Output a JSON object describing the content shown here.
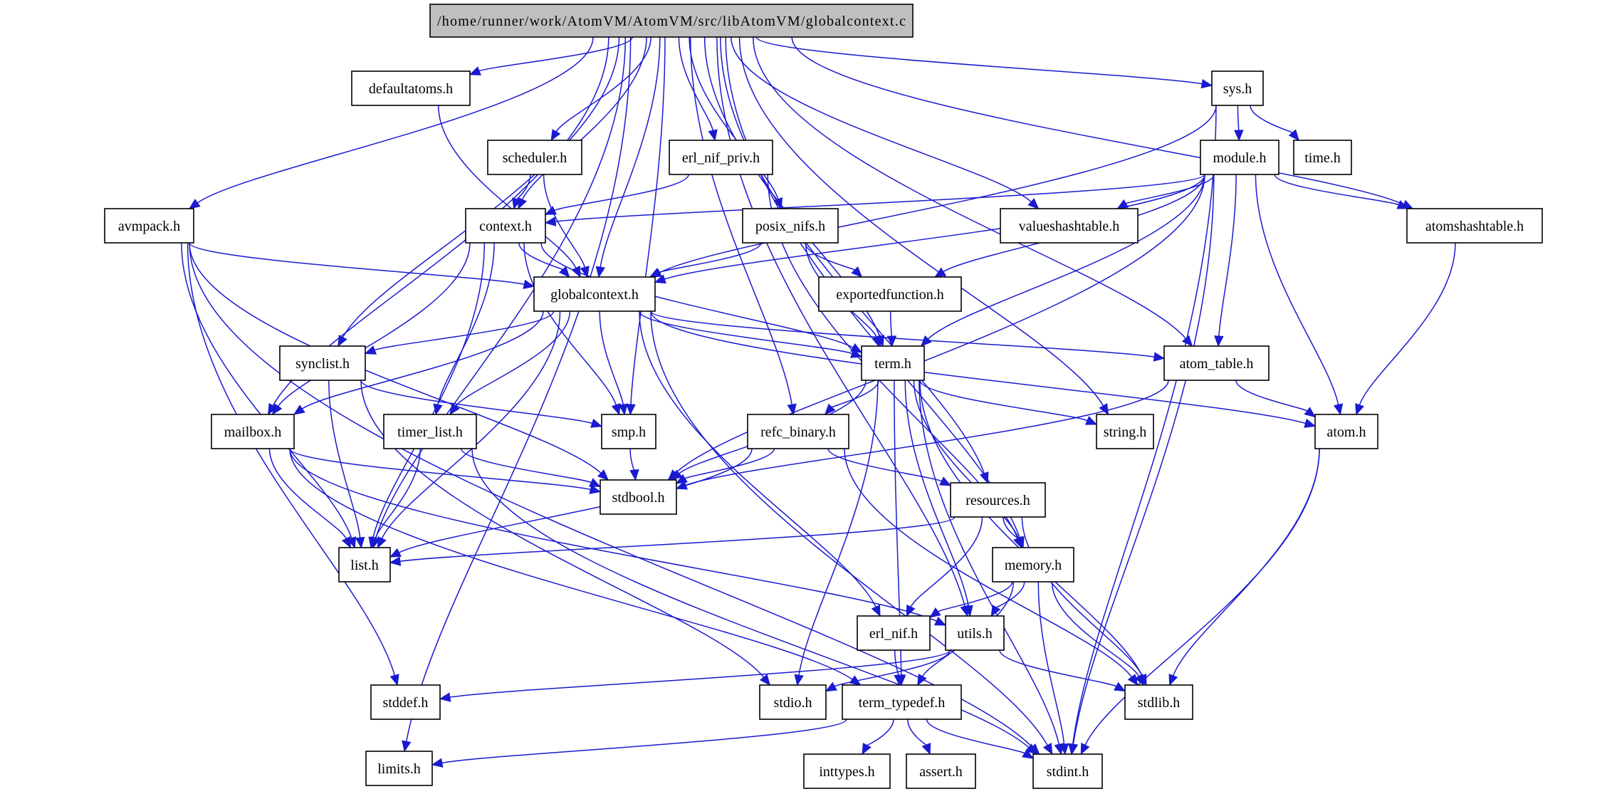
{
  "diagram": {
    "type": "include-dependency-graph",
    "title": "/home/runner/work/AtomVM/AtomVM/src/libAtomVM/globalcontext.c",
    "colors": {
      "edge": "#1a1ad0",
      "root_fill": "#bfbfbf",
      "node_fill": "#ffffff",
      "node_border": "#000000"
    },
    "nodes": [
      {
        "id": "root",
        "label": "/home/runner/work/AtomVM/AtomVM/src/libAtomVM/globalcontext.c",
        "root": true
      },
      {
        "id": "defaultatoms",
        "label": "defaultatoms.h"
      },
      {
        "id": "sys",
        "label": "sys.h"
      },
      {
        "id": "scheduler",
        "label": "scheduler.h"
      },
      {
        "id": "erl_nif_priv",
        "label": "erl_nif_priv.h"
      },
      {
        "id": "module",
        "label": "module.h"
      },
      {
        "id": "time",
        "label": "time.h"
      },
      {
        "id": "avmpack",
        "label": "avmpack.h"
      },
      {
        "id": "context",
        "label": "context.h"
      },
      {
        "id": "posix_nifs",
        "label": "posix_nifs.h"
      },
      {
        "id": "valueshashtable",
        "label": "valueshashtable.h"
      },
      {
        "id": "atomshashtable",
        "label": "atomshashtable.h"
      },
      {
        "id": "globalcontext",
        "label": "globalcontext.h"
      },
      {
        "id": "exportedfunction",
        "label": "exportedfunction.h"
      },
      {
        "id": "synclist",
        "label": "synclist.h"
      },
      {
        "id": "term",
        "label": "term.h"
      },
      {
        "id": "atom_table",
        "label": "atom_table.h"
      },
      {
        "id": "mailbox",
        "label": "mailbox.h"
      },
      {
        "id": "timer_list",
        "label": "timer_list.h"
      },
      {
        "id": "smp",
        "label": "smp.h"
      },
      {
        "id": "refc_binary",
        "label": "refc_binary.h"
      },
      {
        "id": "string",
        "label": "string.h"
      },
      {
        "id": "atom",
        "label": "atom.h"
      },
      {
        "id": "stdbool",
        "label": "stdbool.h"
      },
      {
        "id": "resources",
        "label": "resources.h"
      },
      {
        "id": "list",
        "label": "list.h"
      },
      {
        "id": "memory",
        "label": "memory.h"
      },
      {
        "id": "erl_nif",
        "label": "erl_nif.h"
      },
      {
        "id": "utils",
        "label": "utils.h"
      },
      {
        "id": "stddef",
        "label": "stddef.h"
      },
      {
        "id": "stdio",
        "label": "stdio.h"
      },
      {
        "id": "term_typedef",
        "label": "term_typedef.h"
      },
      {
        "id": "stdlib",
        "label": "stdlib.h"
      },
      {
        "id": "limits",
        "label": "limits.h"
      },
      {
        "id": "inttypes",
        "label": "inttypes.h"
      },
      {
        "id": "assert",
        "label": "assert.h"
      },
      {
        "id": "stdint",
        "label": "stdint.h"
      }
    ],
    "edges": [
      [
        "root",
        "defaultatoms"
      ],
      [
        "root",
        "sys"
      ],
      [
        "root",
        "scheduler"
      ],
      [
        "root",
        "erl_nif_priv"
      ],
      [
        "root",
        "avmpack"
      ],
      [
        "root",
        "context"
      ],
      [
        "root",
        "posix_nifs"
      ],
      [
        "root",
        "valueshashtable"
      ],
      [
        "root",
        "atomshashtable"
      ],
      [
        "root",
        "globalcontext"
      ],
      [
        "root",
        "synclist"
      ],
      [
        "root",
        "term"
      ],
      [
        "root",
        "atom_table"
      ],
      [
        "root",
        "mailbox"
      ],
      [
        "root",
        "smp"
      ],
      [
        "root",
        "refc_binary"
      ],
      [
        "root",
        "string"
      ],
      [
        "root",
        "resources"
      ],
      [
        "root",
        "list"
      ],
      [
        "root",
        "memory"
      ],
      [
        "root",
        "utils"
      ],
      [
        "root",
        "limits"
      ],
      [
        "defaultatoms",
        "globalcontext"
      ],
      [
        "sys",
        "module"
      ],
      [
        "sys",
        "time"
      ],
      [
        "sys",
        "globalcontext"
      ],
      [
        "sys",
        "stdint"
      ],
      [
        "scheduler",
        "context"
      ],
      [
        "scheduler",
        "globalcontext"
      ],
      [
        "erl_nif_priv",
        "context"
      ],
      [
        "erl_nif_priv",
        "memory"
      ],
      [
        "module",
        "context"
      ],
      [
        "module",
        "valueshashtable"
      ],
      [
        "module",
        "atomshashtable"
      ],
      [
        "module",
        "globalcontext"
      ],
      [
        "module",
        "exportedfunction"
      ],
      [
        "module",
        "term"
      ],
      [
        "module",
        "atom_table"
      ],
      [
        "module",
        "atom"
      ],
      [
        "module",
        "stdbool"
      ],
      [
        "module",
        "stdint"
      ],
      [
        "avmpack",
        "globalcontext"
      ],
      [
        "avmpack",
        "list"
      ],
      [
        "avmpack",
        "stdbool"
      ],
      [
        "avmpack",
        "stddef"
      ],
      [
        "avmpack",
        "stdint"
      ],
      [
        "context",
        "globalcontext"
      ],
      [
        "context",
        "term"
      ],
      [
        "context",
        "mailbox"
      ],
      [
        "context",
        "timer_list"
      ],
      [
        "context",
        "smp"
      ],
      [
        "context",
        "list"
      ],
      [
        "posix_nifs",
        "globalcontext"
      ],
      [
        "posix_nifs",
        "exportedfunction"
      ],
      [
        "posix_nifs",
        "term"
      ],
      [
        "atomshashtable",
        "atom"
      ],
      [
        "globalcontext",
        "synclist"
      ],
      [
        "globalcontext",
        "term"
      ],
      [
        "globalcontext",
        "atom_table"
      ],
      [
        "globalcontext",
        "atom"
      ],
      [
        "globalcontext",
        "mailbox"
      ],
      [
        "globalcontext",
        "timer_list"
      ],
      [
        "globalcontext",
        "smp"
      ],
      [
        "globalcontext",
        "list"
      ],
      [
        "globalcontext",
        "erl_nif"
      ],
      [
        "globalcontext",
        "stdint"
      ],
      [
        "exportedfunction",
        "term"
      ],
      [
        "synclist",
        "smp"
      ],
      [
        "synclist",
        "list"
      ],
      [
        "synclist",
        "stdio"
      ],
      [
        "term",
        "refc_binary"
      ],
      [
        "term",
        "string"
      ],
      [
        "term",
        "stdbool"
      ],
      [
        "term",
        "memory"
      ],
      [
        "term",
        "utils"
      ],
      [
        "term",
        "stdio"
      ],
      [
        "term",
        "term_typedef"
      ],
      [
        "term",
        "stdlib"
      ],
      [
        "term",
        "stdint"
      ],
      [
        "atom_table",
        "atom"
      ],
      [
        "atom_table",
        "stdbool"
      ],
      [
        "mailbox",
        "list"
      ],
      [
        "mailbox",
        "stdbool"
      ],
      [
        "mailbox",
        "utils"
      ],
      [
        "mailbox",
        "term_typedef"
      ],
      [
        "timer_list",
        "list"
      ],
      [
        "timer_list",
        "stdbool"
      ],
      [
        "timer_list",
        "stdint"
      ],
      [
        "smp",
        "stdbool"
      ],
      [
        "refc_binary",
        "stdbool"
      ],
      [
        "refc_binary",
        "list"
      ],
      [
        "refc_binary",
        "resources"
      ],
      [
        "refc_binary",
        "stdlib"
      ],
      [
        "atom",
        "stdlib"
      ],
      [
        "atom",
        "stdint"
      ],
      [
        "resources",
        "list"
      ],
      [
        "resources",
        "memory"
      ],
      [
        "resources",
        "erl_nif"
      ],
      [
        "resources",
        "stdlib"
      ],
      [
        "memory",
        "erl_nif"
      ],
      [
        "memory",
        "utils"
      ],
      [
        "memory",
        "term_typedef"
      ],
      [
        "memory",
        "stdlib"
      ],
      [
        "memory",
        "stdint"
      ],
      [
        "erl_nif",
        "term_typedef"
      ],
      [
        "utils",
        "stdio"
      ],
      [
        "utils",
        "stddef"
      ],
      [
        "utils",
        "stdlib"
      ],
      [
        "term_typedef",
        "limits"
      ],
      [
        "term_typedef",
        "inttypes"
      ],
      [
        "term_typedef",
        "assert"
      ],
      [
        "term_typedef",
        "stdint"
      ]
    ]
  }
}
